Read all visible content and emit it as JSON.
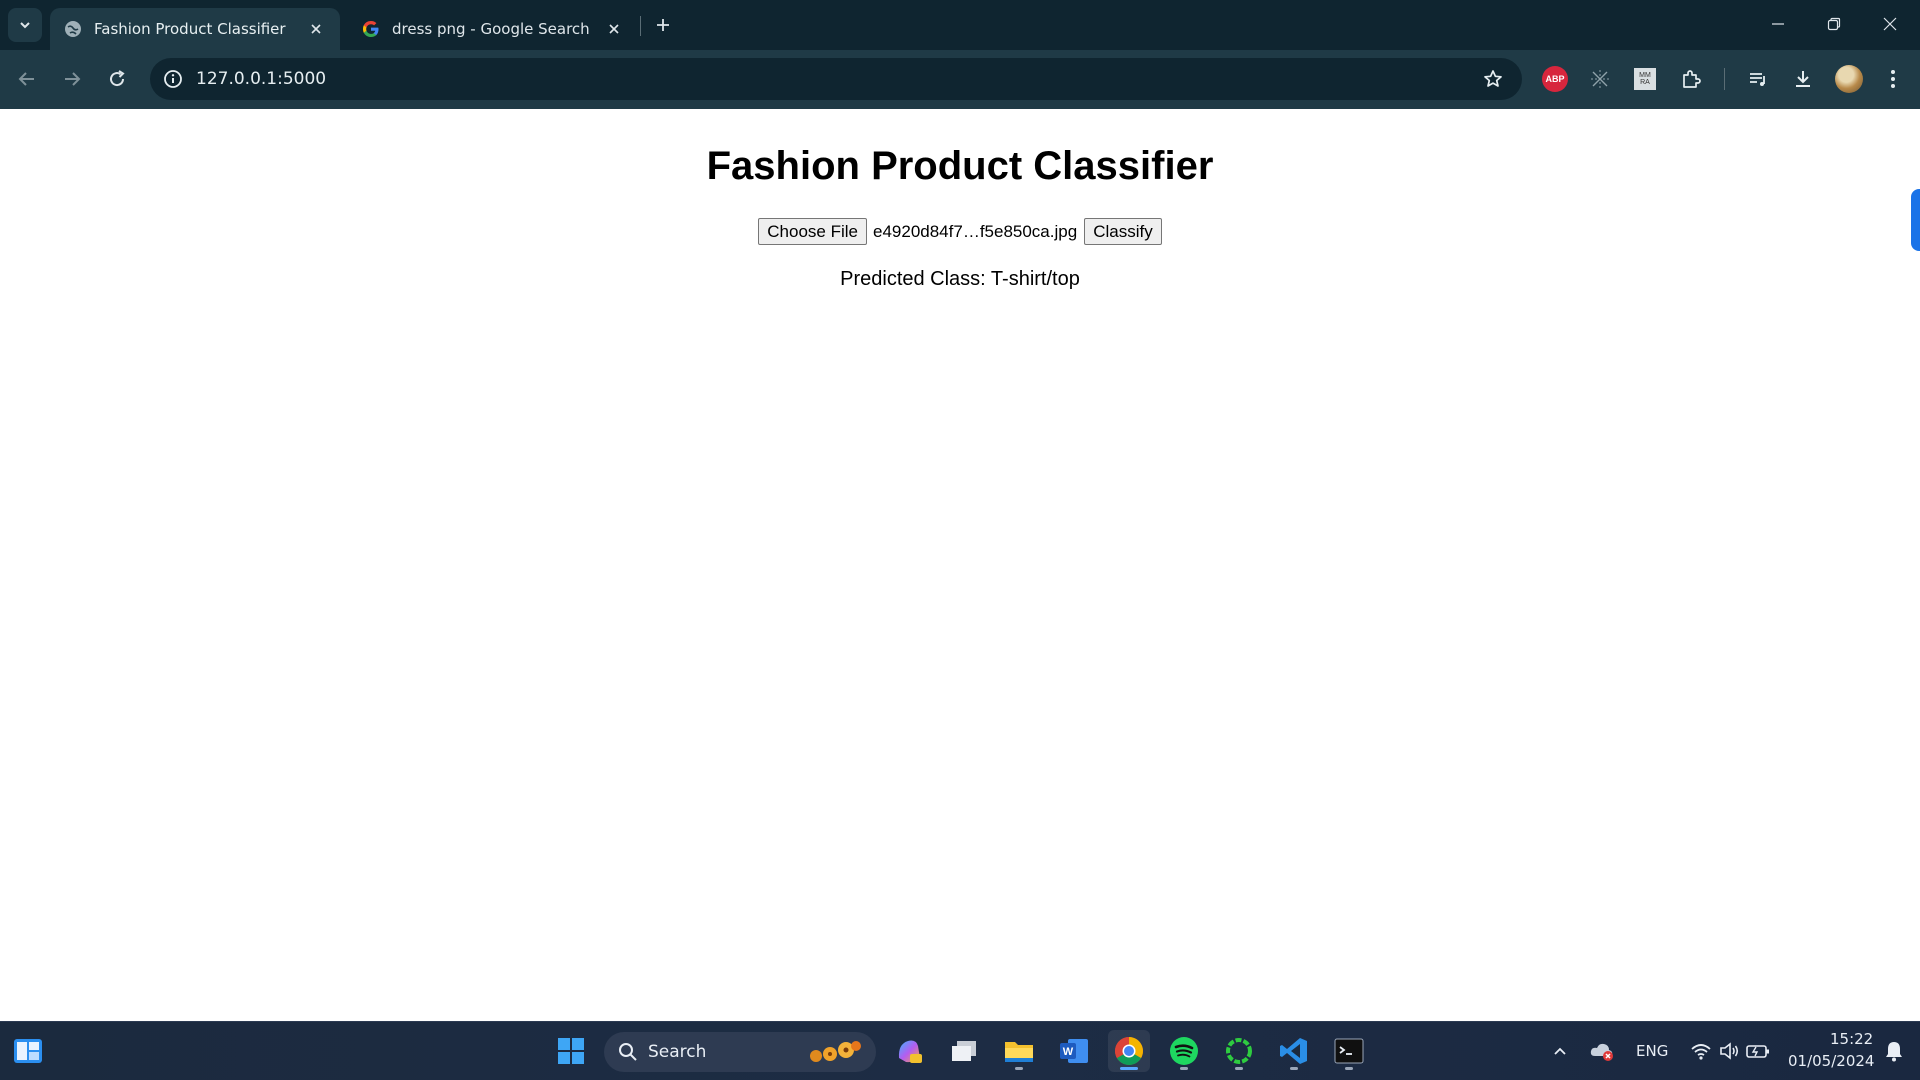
{
  "browser": {
    "tabs": [
      {
        "title": "Fashion Product Classifier",
        "active": true
      },
      {
        "title": "dress png - Google Search",
        "active": false
      }
    ],
    "url": "127.0.0.1:5000",
    "extensions": {
      "abp_label": "ABP",
      "mmra_label": "MM RA"
    }
  },
  "page": {
    "title": "Fashion Product Classifier",
    "choose_file_label": "Choose File",
    "file_name": "e4920d84f7…f5e850ca.jpg",
    "classify_label": "Classify",
    "result_text": "Predicted Class: T-shirt/top"
  },
  "taskbar": {
    "search_label": "Search",
    "language": "ENG",
    "time": "15:22",
    "date": "01/05/2024"
  },
  "colors": {
    "tabstrip_bg": "#0f2530",
    "toolbar_bg": "#1f3a46",
    "accent": "#1a73e8",
    "abp_red": "#d7263d"
  }
}
